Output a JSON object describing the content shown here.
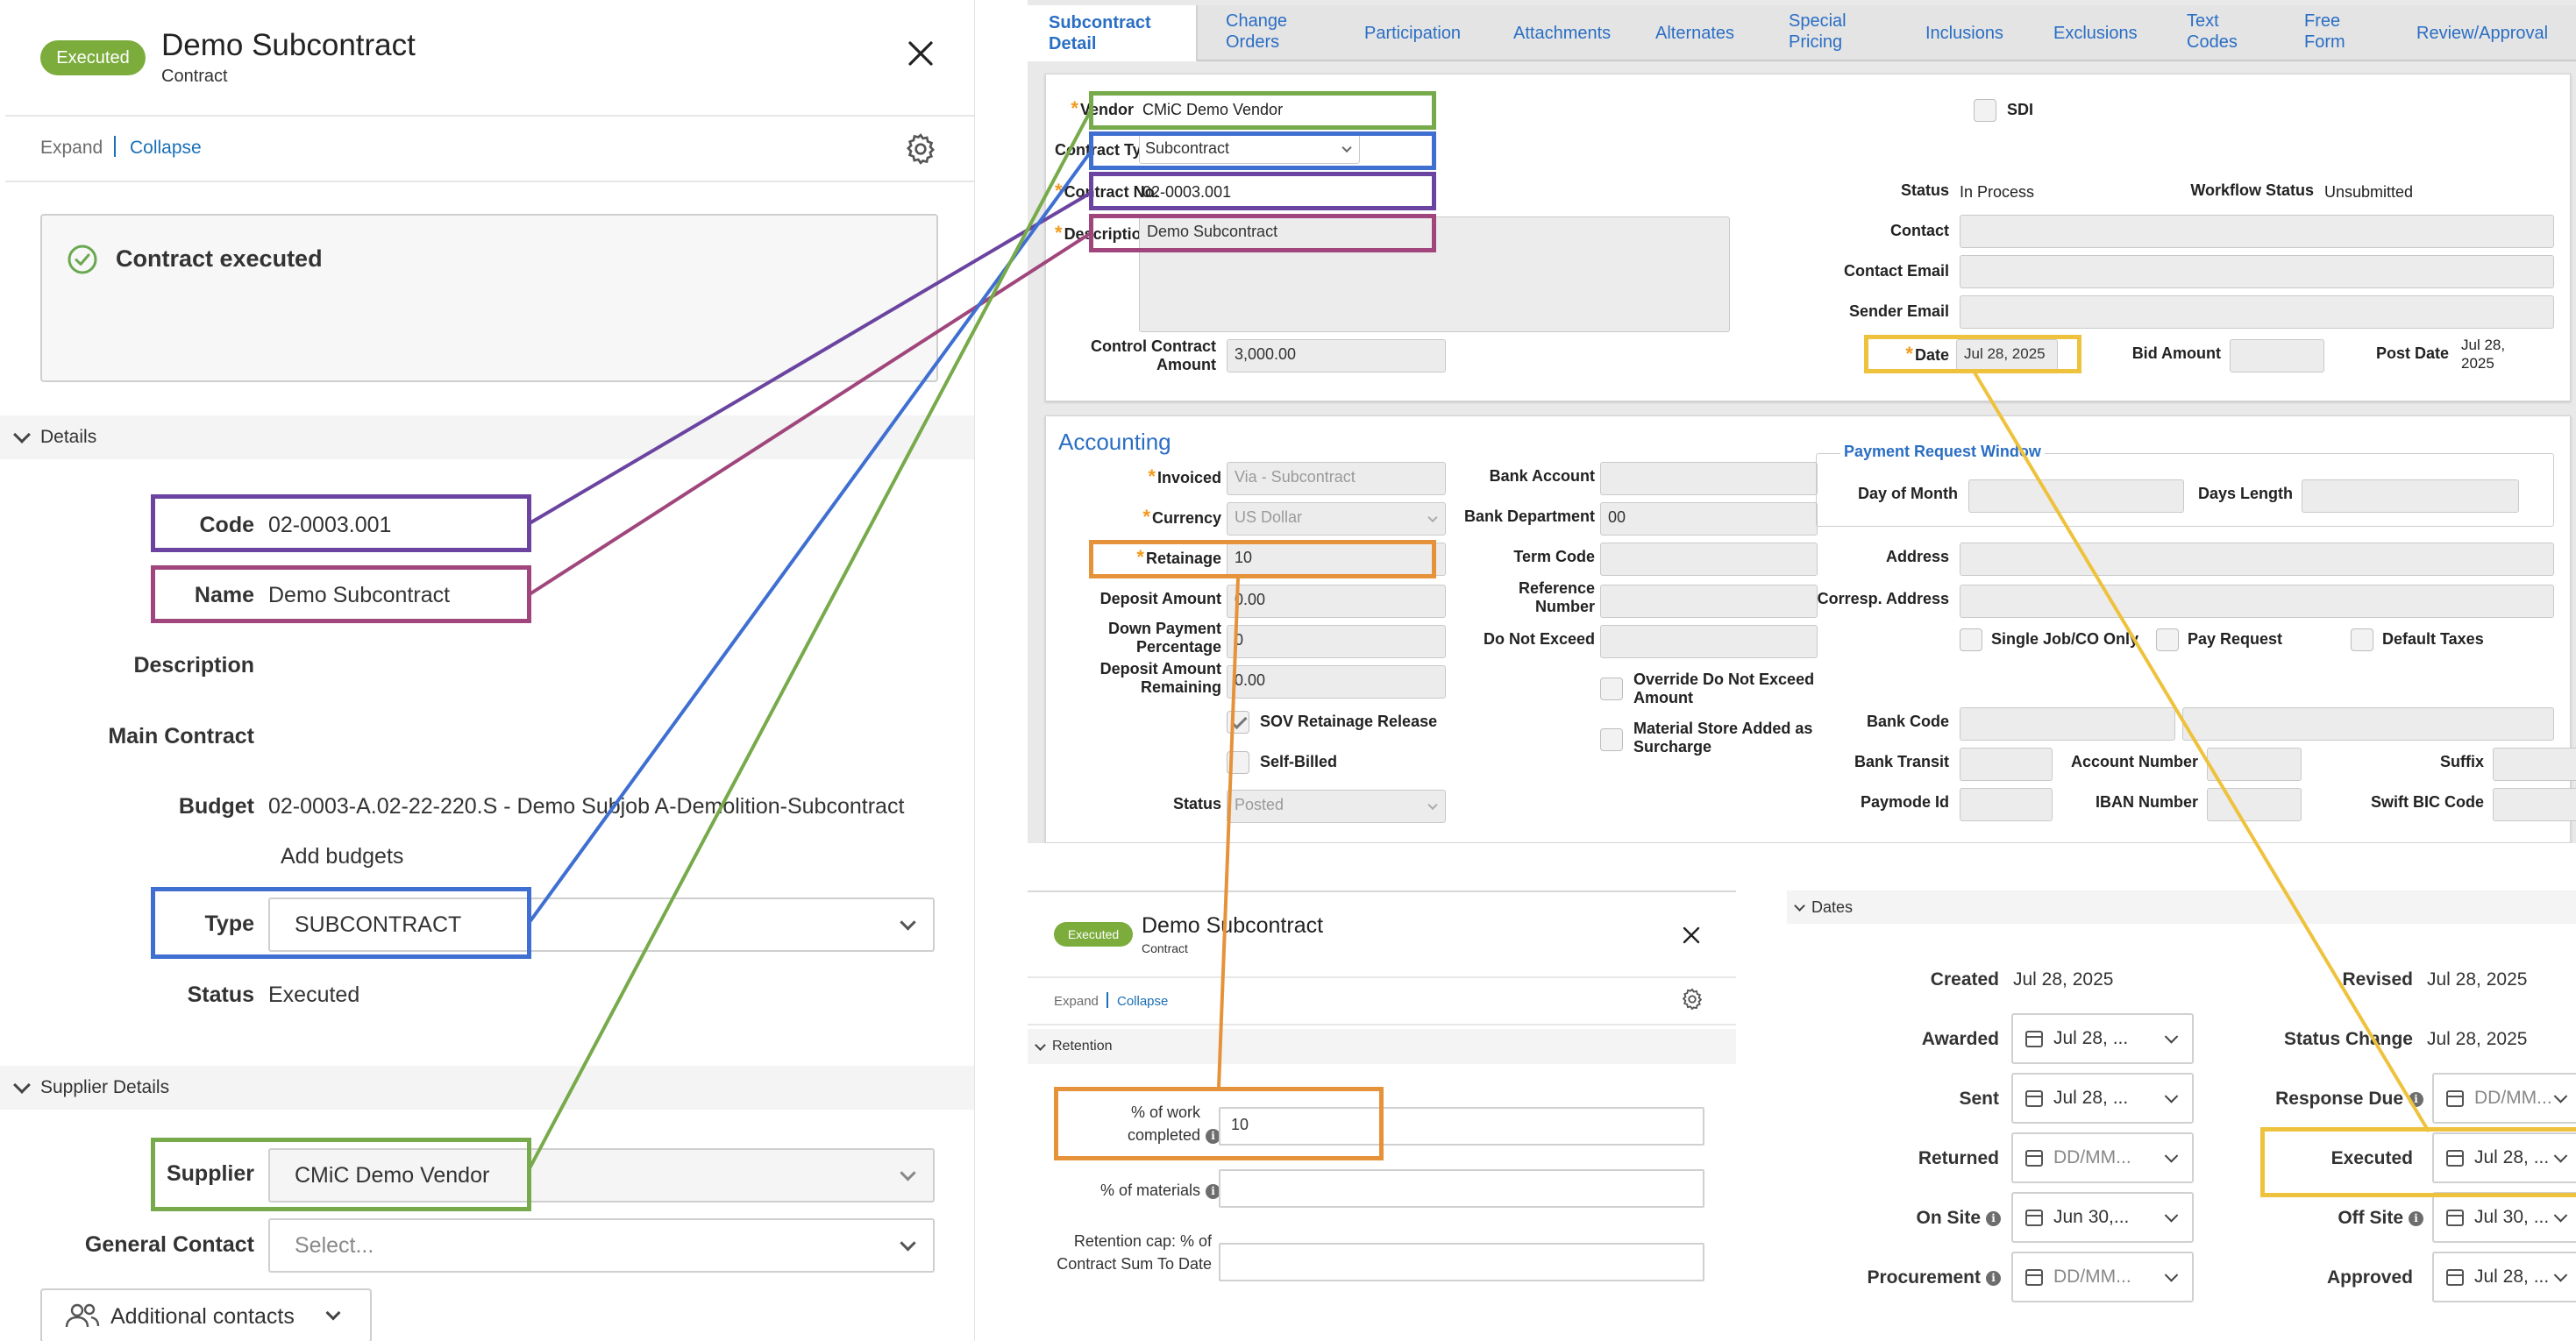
{
  "colors": {
    "accent": "#1a6fb5",
    "executed_badge": "#7cad3c",
    "highlight_code": "#6a44a0",
    "highlight_name": "#a0467c",
    "highlight_type": "#3e6fd1",
    "highlight_supplier": "#76aa4a",
    "highlight_retainage": "#e6923a",
    "highlight_date": "#eec23d"
  },
  "left": {
    "badge": "Executed",
    "title": "Demo Subcontract",
    "subtitle": "Contract",
    "expand": "Expand",
    "collapse": "Collapse",
    "alert": "Contract executed",
    "details_section": "Details",
    "code_label": "Code",
    "code_value": "02-0003.001",
    "name_label": "Name",
    "name_value": "Demo Subcontract",
    "description_label": "Description",
    "main_contract_label": "Main Contract",
    "budget_label": "Budget",
    "budget_value": "02-0003-A.02-22-220.S - Demo Subjob A-Demolition-Subcontract",
    "add_budgets": "Add budgets",
    "type_label": "Type",
    "type_value": "SUBCONTRACT",
    "status_label": "Status",
    "status_value": "Executed",
    "supplier_section": "Supplier Details",
    "supplier_label": "Supplier",
    "supplier_value": "CMiC Demo Vendor",
    "general_contact_label": "General Contact",
    "general_contact_placeholder": "Select...",
    "additional_contacts": "Additional contacts"
  },
  "cmic": {
    "tabs": [
      "Subcontract Detail",
      "Change Orders",
      "Participation",
      "Attachments",
      "Alternates",
      "Special Pricing",
      "Inclusions",
      "Exclusions",
      "Text Codes",
      "Free Form",
      "Review/Approval"
    ],
    "vendor_label": "Vendor",
    "vendor_value": "CMiC Demo Vendor",
    "contract_type_label": "Contract Type",
    "contract_type_value": "Subcontract",
    "contract_no_label": "Contract No.",
    "contract_no_value": "02-0003.001",
    "description_label": "Description",
    "description_value": "Demo Subcontract",
    "control_amount_label": "Control Contract Amount",
    "control_amount_value": "3,000.00",
    "sdi_label": "SDI",
    "status_label": "Status",
    "status_value": "In Process",
    "workflow_label": "Workflow Status",
    "workflow_value": "Unsubmitted",
    "contact_label": "Contact",
    "contact_email_label": "Contact Email",
    "sender_email_label": "Sender Email",
    "date_label": "Date",
    "date_value": "Jul 28, 2025",
    "bid_amount_label": "Bid Amount",
    "post_date_label": "Post Date",
    "post_date_value": "Jul 28, 2025",
    "accounting_title": "Accounting",
    "invoiced_label": "Invoiced",
    "invoiced_value": "Via - Subcontract",
    "currency_label": "Currency",
    "currency_value": "US Dollar",
    "retainage_label": "Retainage",
    "retainage_value": "10",
    "deposit_amount_label": "Deposit Amount",
    "deposit_amount_value": "0.00",
    "down_payment_label": "Down Payment Percentage",
    "down_payment_value": "0",
    "deposit_remaining_label": "Deposit Amount Remaining",
    "deposit_remaining_value": "0.00",
    "sov_label": "SOV Retainage Release",
    "self_billed_label": "Self-Billed",
    "status2_label": "Status",
    "status2_value": "Posted",
    "bank_account_label": "Bank Account",
    "bank_department_label": "Bank Department",
    "bank_department_value": "00",
    "term_code_label": "Term Code",
    "reference_number_label": "Reference Number",
    "do_not_exceed_label": "Do Not Exceed",
    "override_label": "Override Do Not Exceed Amount",
    "material_store_label": "Material Store Added as Surcharge",
    "payment_window_title": "Payment Request Window",
    "day_of_month_label": "Day of Month",
    "days_length_label": "Days Length",
    "address_label": "Address",
    "corresp_address_label": "Corresp. Address",
    "single_job_label": "Single Job/CO Only",
    "pay_request_label": "Pay Request",
    "default_taxes_label": "Default Taxes",
    "bank_code_label": "Bank Code",
    "bank_transit_label": "Bank Transit",
    "account_number_label": "Account Number",
    "suffix_label": "Suffix",
    "paymode_label": "Paymode Id",
    "iban_label": "IBAN Number",
    "swift_label": "Swift BIC Code"
  },
  "mini": {
    "badge": "Executed",
    "title": "Demo Subcontract",
    "subtitle": "Contract",
    "expand": "Expand",
    "collapse": "Collapse",
    "retention_section": "Retention",
    "work_completed_label": "% of work completed",
    "work_completed_value": "10",
    "materials_label": "% of materials",
    "retention_cap_label": "Retention cap: % of Contract Sum To Date"
  },
  "dates": {
    "section": "Dates",
    "created_label": "Created",
    "created_value": "Jul 28, 2025",
    "revised_label": "Revised",
    "revised_value": "Jul 28, 2025",
    "awarded_label": "Awarded",
    "awarded_value": "Jul 28, ...",
    "status_change_label": "Status Change",
    "status_change_value": "Jul 28, 2025",
    "sent_label": "Sent",
    "sent_value": "Jul 28, ...",
    "response_due_label": "Response Due",
    "response_due_placeholder": "DD/MM...",
    "returned_label": "Returned",
    "returned_placeholder": "DD/MM...",
    "executed_label": "Executed",
    "executed_value": "Jul 28, ...",
    "on_site_label": "On Site",
    "on_site_value": "Jun 30,...",
    "off_site_label": "Off Site",
    "off_site_value": "Jul 30, ...",
    "procurement_label": "Procurement",
    "procurement_placeholder": "DD/MM...",
    "approved_label": "Approved",
    "approved_value": "Jul 28, ..."
  }
}
